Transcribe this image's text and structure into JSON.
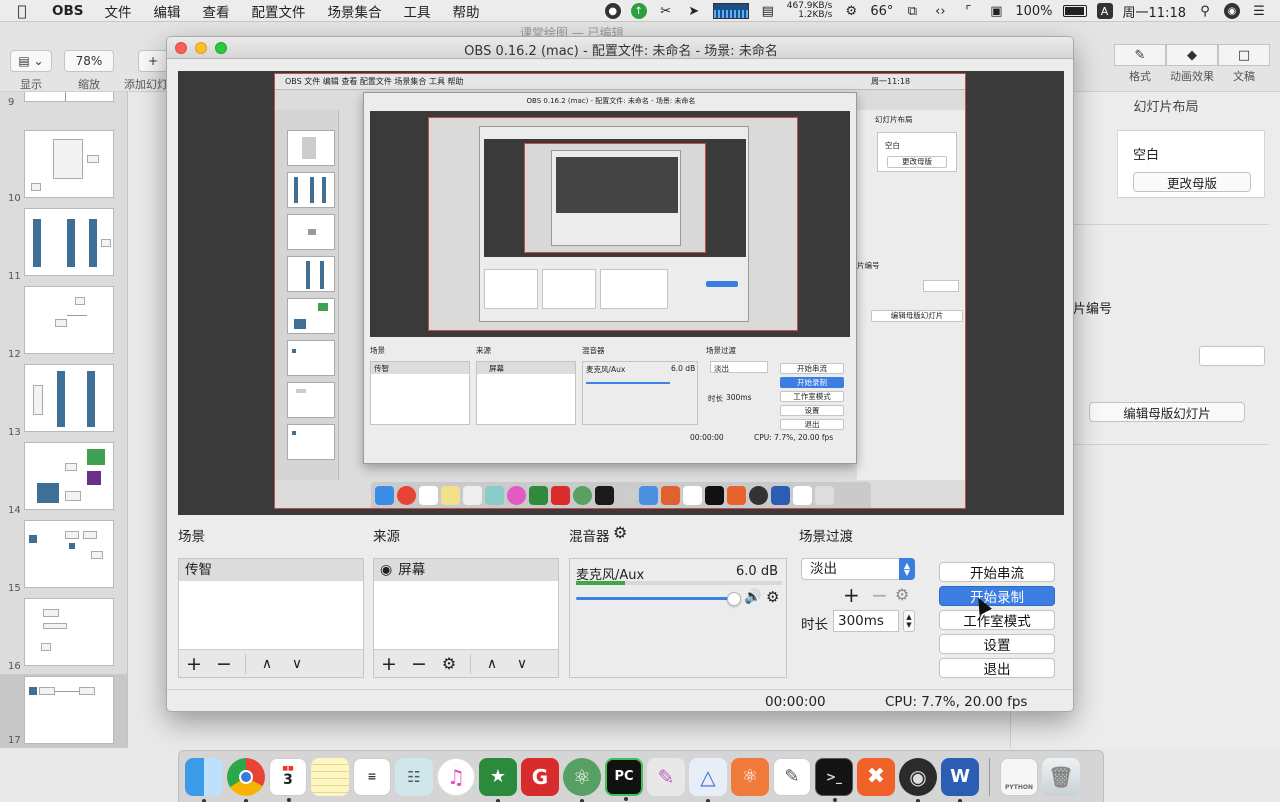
{
  "menubar": {
    "app": "OBS",
    "items": [
      "文件",
      "编辑",
      "查看",
      "配置文件",
      "场景集合",
      "工具",
      "帮助"
    ],
    "net_up": "467.9KB/s",
    "net_down": "1.2KB/s",
    "temperature": "66°",
    "battery": "100%",
    "ime": "A",
    "clock": "周一11:18"
  },
  "keynote": {
    "title": "课堂绘图 — 已编辑",
    "view_label": "显示",
    "zoom_value": "78%",
    "zoom_label": "缩放",
    "add_slide_label": "添加幻灯",
    "tabs": [
      "格式",
      "动画效果",
      "文稿"
    ],
    "inspector": {
      "layout_title": "幻灯片布局",
      "blank": "空白",
      "change_master": "更改母版",
      "slide_number": "片编号",
      "edit_master": "编辑母版幻灯片"
    },
    "slide_numbers": [
      "9",
      "10",
      "11",
      "12",
      "13",
      "14",
      "15",
      "16",
      "17"
    ]
  },
  "obs": {
    "window_title": "OBS 0.16.2 (mac) - 配置文件: 未命名 - 场景: 未命名",
    "scenes_label": "场景",
    "sources_label": "来源",
    "mixer_label": "混音器",
    "transition_label": "场景过渡",
    "scene_item": "传智",
    "source_item": "屏幕",
    "mixer": {
      "name": "麦克风/Aux",
      "db": "6.0 dB",
      "meter_level": 0.24,
      "volume_level": 1.0
    },
    "transition": {
      "value": "淡出",
      "duration_label": "时长",
      "duration_value": "300ms"
    },
    "buttons": {
      "stream": "开始串流",
      "record": "开始录制",
      "studio": "工作室模式",
      "settings": "设置",
      "exit": "退出"
    },
    "status": {
      "time": "00:00:00",
      "cpu": "CPU: 7.7%, 20.00 fps"
    }
  },
  "nested_preview": {
    "menubar": "OBS 文件 编辑 查看 配置文件 场景集合 工具 帮助",
    "clock": "周一11:18",
    "window_title": "OBS 0.16.2 (mac) - 配置文件: 未命名 - 场景: 未命名",
    "scenes_label": "场景",
    "sources_label": "来源",
    "mixer_label": "混音器",
    "transition_label": "场景过渡",
    "scene_item": "传智",
    "source_item": "屏幕",
    "mixer_name": "麦克风/Aux",
    "mixer_db": "6.0 dB",
    "transition_value": "淡出",
    "duration": "时长",
    "duration_value": "300ms",
    "btn_stream": "开始串流",
    "btn_record": "开始录制",
    "btn_studio": "工作室模式",
    "btn_settings": "设置",
    "btn_exit": "退出",
    "time": "00:00:00",
    "cpu": "CPU: 7.7%, 20.00 fps",
    "insp_title": "幻灯片布局",
    "insp_blank": "空白",
    "insp_change": "更改母版",
    "insp_number": "片编号",
    "insp_edit": "编辑母版幻灯片"
  },
  "dock": {
    "apps": [
      "finder-icon",
      "chrome-icon",
      "calendar-icon",
      "notes-icon",
      "reminders-icon",
      "preview-icon",
      "itunes-icon",
      "evernote-icon",
      "g-icon",
      "atom-icon",
      "pycharm-icon",
      "sketch-icon",
      "keynote-icon",
      "instruments-icon",
      "textedit-icon",
      "terminal-icon",
      "xmind-icon",
      "obs-icon",
      "word-icon",
      "python-doc-icon",
      "trash-icon"
    ],
    "calendar_day": "3",
    "python_label": "PYTHON"
  },
  "colors": {
    "accent_blue": "#3b7de0",
    "meter_green": "#3fa748",
    "preview_border": "#c84a4a"
  }
}
